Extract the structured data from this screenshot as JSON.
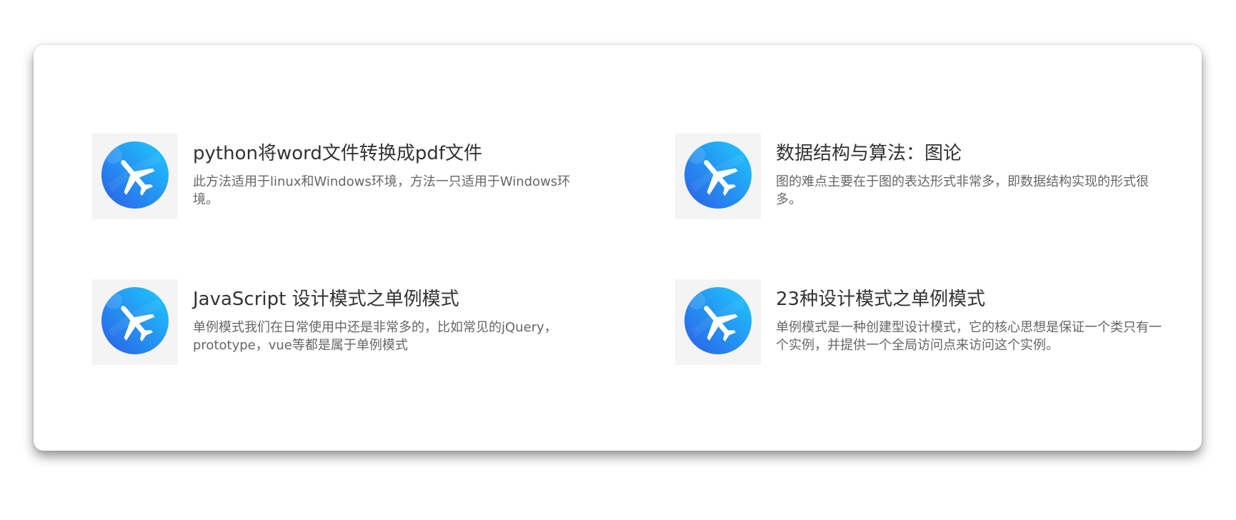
{
  "articles": [
    {
      "title": "python将word文件转换成pdf文件",
      "description": "此方法适用于linux和Windows环境，方法一只适用于Windows环境。",
      "icon": "airplane-icon"
    },
    {
      "title": "数据结构与算法：图论",
      "description": "图的难点主要在于图的表达形式非常多，即数据结构实现的形式很多。",
      "icon": "airplane-icon"
    },
    {
      "title": "JavaScript 设计模式之单例模式",
      "description": "单例模式我们在日常使用中还是非常多的，比如常见的jQuery，prototype，vue等都是属于单例模式",
      "icon": "airplane-icon"
    },
    {
      "title": "23种设计模式之单例模式",
      "description": "单例模式是一种创建型设计模式，它的核心思想是保证一个类只有一个实例，并提供一个全局访问点来访问这个实例。",
      "icon": "airplane-icon"
    }
  ],
  "colors": {
    "icon_gradient_start": "#2b63e8",
    "icon_gradient_end": "#1ec8ff",
    "title": "#333333",
    "description": "#666666"
  }
}
